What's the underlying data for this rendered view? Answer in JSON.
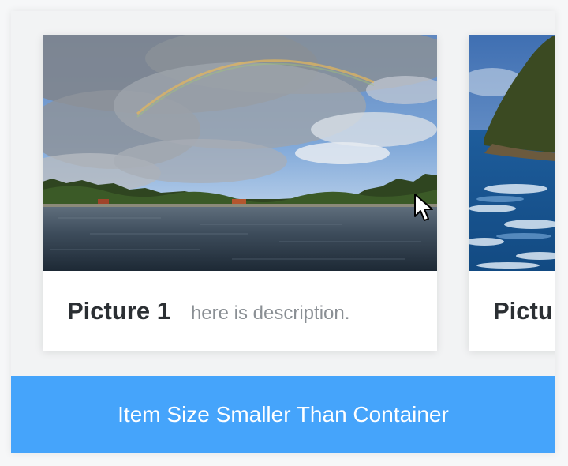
{
  "cards": [
    {
      "title": "Picture 1",
      "description": "here is description.",
      "image": "lake-with-rainbow"
    },
    {
      "title": "Pictu",
      "image": "rocky-coast-waves"
    }
  ],
  "footer": {
    "label": "Item Size Smaller Than Container"
  },
  "colors": {
    "accent": "#45a4fb",
    "title": "#2b2f33",
    "description": "#8a8f94"
  },
  "cursor": {
    "icon": "arrow-cursor-icon"
  }
}
